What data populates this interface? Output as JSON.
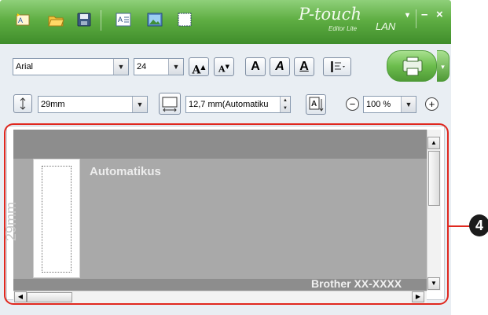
{
  "app": {
    "brand": "P-touch",
    "subtitle": "Editor Lite",
    "edition": "LAN"
  },
  "titlebar": {
    "minimize_glyph": "–",
    "close_glyph": "×",
    "dropdown_glyph": "▾"
  },
  "quick_access": [
    "new-icon",
    "open-icon",
    "save-icon",
    "insert-text-icon",
    "insert-image-icon",
    "frame-icon"
  ],
  "toolbar": {
    "font": "Arial",
    "font_size": "24",
    "grow_label": "A",
    "shrink_label": "A",
    "bold_label": "A",
    "italic_label": "A",
    "underline_label": "A",
    "print_dropdown_glyph": "▾"
  },
  "toolbar2": {
    "tape_width": "29mm",
    "label_length": "12,7 mm(Automatiku",
    "zoom": "100 %",
    "zoom_out_glyph": "−",
    "zoom_in_glyph": "+"
  },
  "canvas": {
    "label_text": "Automatikus",
    "tape_width_label": "29mm",
    "printer_name": "Brother XX-XXXX"
  },
  "callout": {
    "number": "4"
  },
  "colors": {
    "titlebar_green": "#5fae43",
    "highlight_red": "#e0281f",
    "canvas_gray": "#a9a9a9"
  }
}
